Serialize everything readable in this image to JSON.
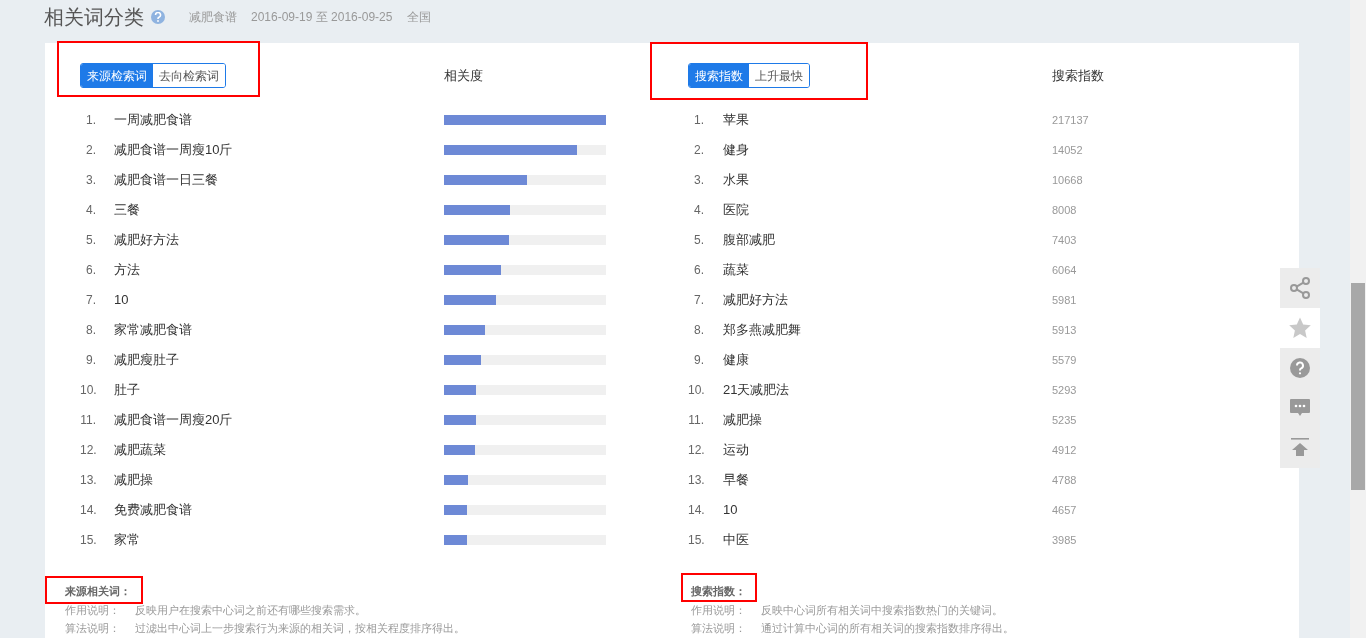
{
  "header": {
    "title": "相关词分类",
    "keyword": "减肥食谱",
    "date_range": "2016-09-19 至 2016-09-25",
    "region": "全国"
  },
  "left": {
    "tabs": [
      {
        "label": "来源检索词",
        "selected": true
      },
      {
        "label": "去向检索词",
        "selected": false
      }
    ],
    "column_header": "相关度",
    "rows": [
      {
        "rank": "1.",
        "word": "一周减肥食谱",
        "level": 1.0
      },
      {
        "rank": "2.",
        "word": "减肥食谱一周瘦10斤",
        "level": 0.82
      },
      {
        "rank": "3.",
        "word": "减肥食谱一日三餐",
        "level": 0.51
      },
      {
        "rank": "4.",
        "word": "三餐",
        "level": 0.41
      },
      {
        "rank": "5.",
        "word": "减肥好方法",
        "level": 0.4
      },
      {
        "rank": "6.",
        "word": "方法",
        "level": 0.35
      },
      {
        "rank": "7.",
        "word": "10",
        "level": 0.32
      },
      {
        "rank": "8.",
        "word": "家常减肥食谱",
        "level": 0.25
      },
      {
        "rank": "9.",
        "word": "减肥瘦肚子",
        "level": 0.23
      },
      {
        "rank": "10.",
        "word": "肚子",
        "level": 0.2
      },
      {
        "rank": "11.",
        "word": "减肥食谱一周瘦20斤",
        "level": 0.2
      },
      {
        "rank": "12.",
        "word": "减肥蔬菜",
        "level": 0.19
      },
      {
        "rank": "13.",
        "word": "减肥操",
        "level": 0.15
      },
      {
        "rank": "14.",
        "word": "免费减肥食谱",
        "level": 0.14
      },
      {
        "rank": "15.",
        "word": "家常",
        "level": 0.14
      }
    ],
    "note": {
      "title": "来源相关词：",
      "lines": [
        {
          "label": "作用说明：",
          "text": "反映用户在搜索中心词之前还有哪些搜索需求。"
        },
        {
          "label": "算法说明：",
          "text": "过滤出中心词上一步搜索行为来源的相关词，按相关程度排序得出。"
        }
      ]
    }
  },
  "right": {
    "tabs": [
      {
        "label": "搜索指数",
        "selected": true
      },
      {
        "label": "上升最快",
        "selected": false
      }
    ],
    "column_header": "搜索指数",
    "rows": [
      {
        "rank": "1.",
        "word": "苹果",
        "value": "217137"
      },
      {
        "rank": "2.",
        "word": "健身",
        "value": "14052"
      },
      {
        "rank": "3.",
        "word": "水果",
        "value": "10668"
      },
      {
        "rank": "4.",
        "word": "医院",
        "value": "8008"
      },
      {
        "rank": "5.",
        "word": "腹部减肥",
        "value": "7403"
      },
      {
        "rank": "6.",
        "word": "蔬菜",
        "value": "6064"
      },
      {
        "rank": "7.",
        "word": "减肥好方法",
        "value": "5981"
      },
      {
        "rank": "8.",
        "word": "郑多燕减肥舞",
        "value": "5913"
      },
      {
        "rank": "9.",
        "word": "健康",
        "value": "5579"
      },
      {
        "rank": "10.",
        "word": "21天减肥法",
        "value": "5293"
      },
      {
        "rank": "11.",
        "word": "减肥操",
        "value": "5235"
      },
      {
        "rank": "12.",
        "word": "运动",
        "value": "4912"
      },
      {
        "rank": "13.",
        "word": "早餐",
        "value": "4788"
      },
      {
        "rank": "14.",
        "word": "10",
        "value": "4657"
      },
      {
        "rank": "15.",
        "word": "中医",
        "value": "3985"
      }
    ],
    "note": {
      "title": "搜索指数：",
      "lines": [
        {
          "label": "作用说明：",
          "text": "反映中心词所有相关词中搜索指数热门的关键词。"
        },
        {
          "label": "算法说明：",
          "text": "通过计算中心词的所有相关词的搜索指数排序得出。"
        }
      ]
    }
  },
  "side_tools": [
    {
      "kind": "share",
      "selected": false
    },
    {
      "kind": "star",
      "selected": true
    },
    {
      "kind": "help",
      "selected": false
    },
    {
      "kind": "comment",
      "selected": false
    },
    {
      "kind": "top",
      "selected": false
    }
  ]
}
